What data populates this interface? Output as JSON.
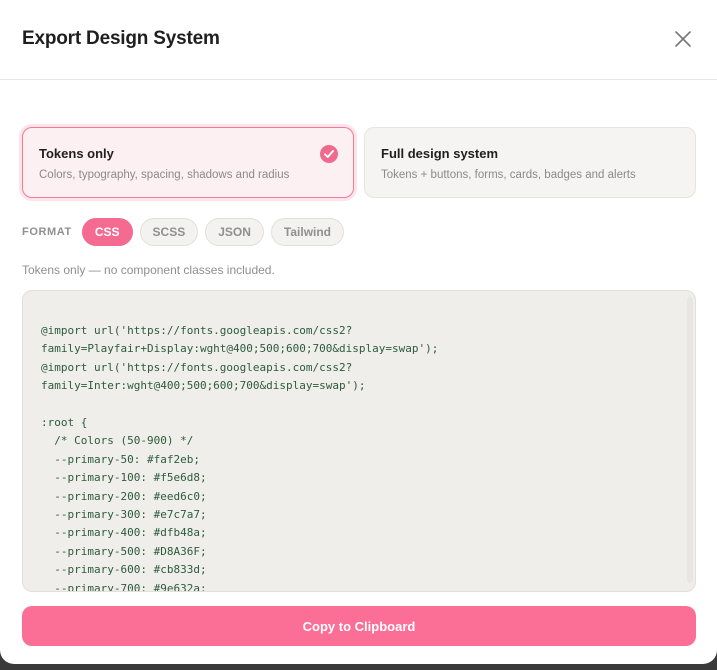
{
  "dialog": {
    "title": "Export Design System",
    "close_icon": "close-icon"
  },
  "options": [
    {
      "title": "Tokens only",
      "description": "Colors, typography, spacing, shadows and radius",
      "selected": true
    },
    {
      "title": "Full design system",
      "description": "Tokens + buttons, forms, cards, badges and alerts",
      "selected": false
    }
  ],
  "format": {
    "label": "FORMAT",
    "chips": [
      "CSS",
      "SCSS",
      "JSON",
      "Tailwind"
    ],
    "active": "CSS"
  },
  "note": "Tokens only — no component classes included.",
  "code": "@import url('https://fonts.googleapis.com/css2?\nfamily=Playfair+Display:wght@400;500;600;700&display=swap');\n@import url('https://fonts.googleapis.com/css2?\nfamily=Inter:wght@400;500;600;700&display=swap');\n\n:root {\n  /* Colors (50-900) */\n  --primary-50: #faf2eb;\n  --primary-100: #f5e6d8;\n  --primary-200: #eed6c0;\n  --primary-300: #e7c7a7;\n  --primary-400: #dfb48a;\n  --primary-500: #D8A36F;\n  --primary-600: #cb833d;\n  --primary-700: #9e632a;",
  "copy_button": "Copy to Clipboard",
  "colors": {
    "accent": "#f46a91",
    "selected_border": "#f07a97",
    "code_text": "#2c5a3c"
  }
}
